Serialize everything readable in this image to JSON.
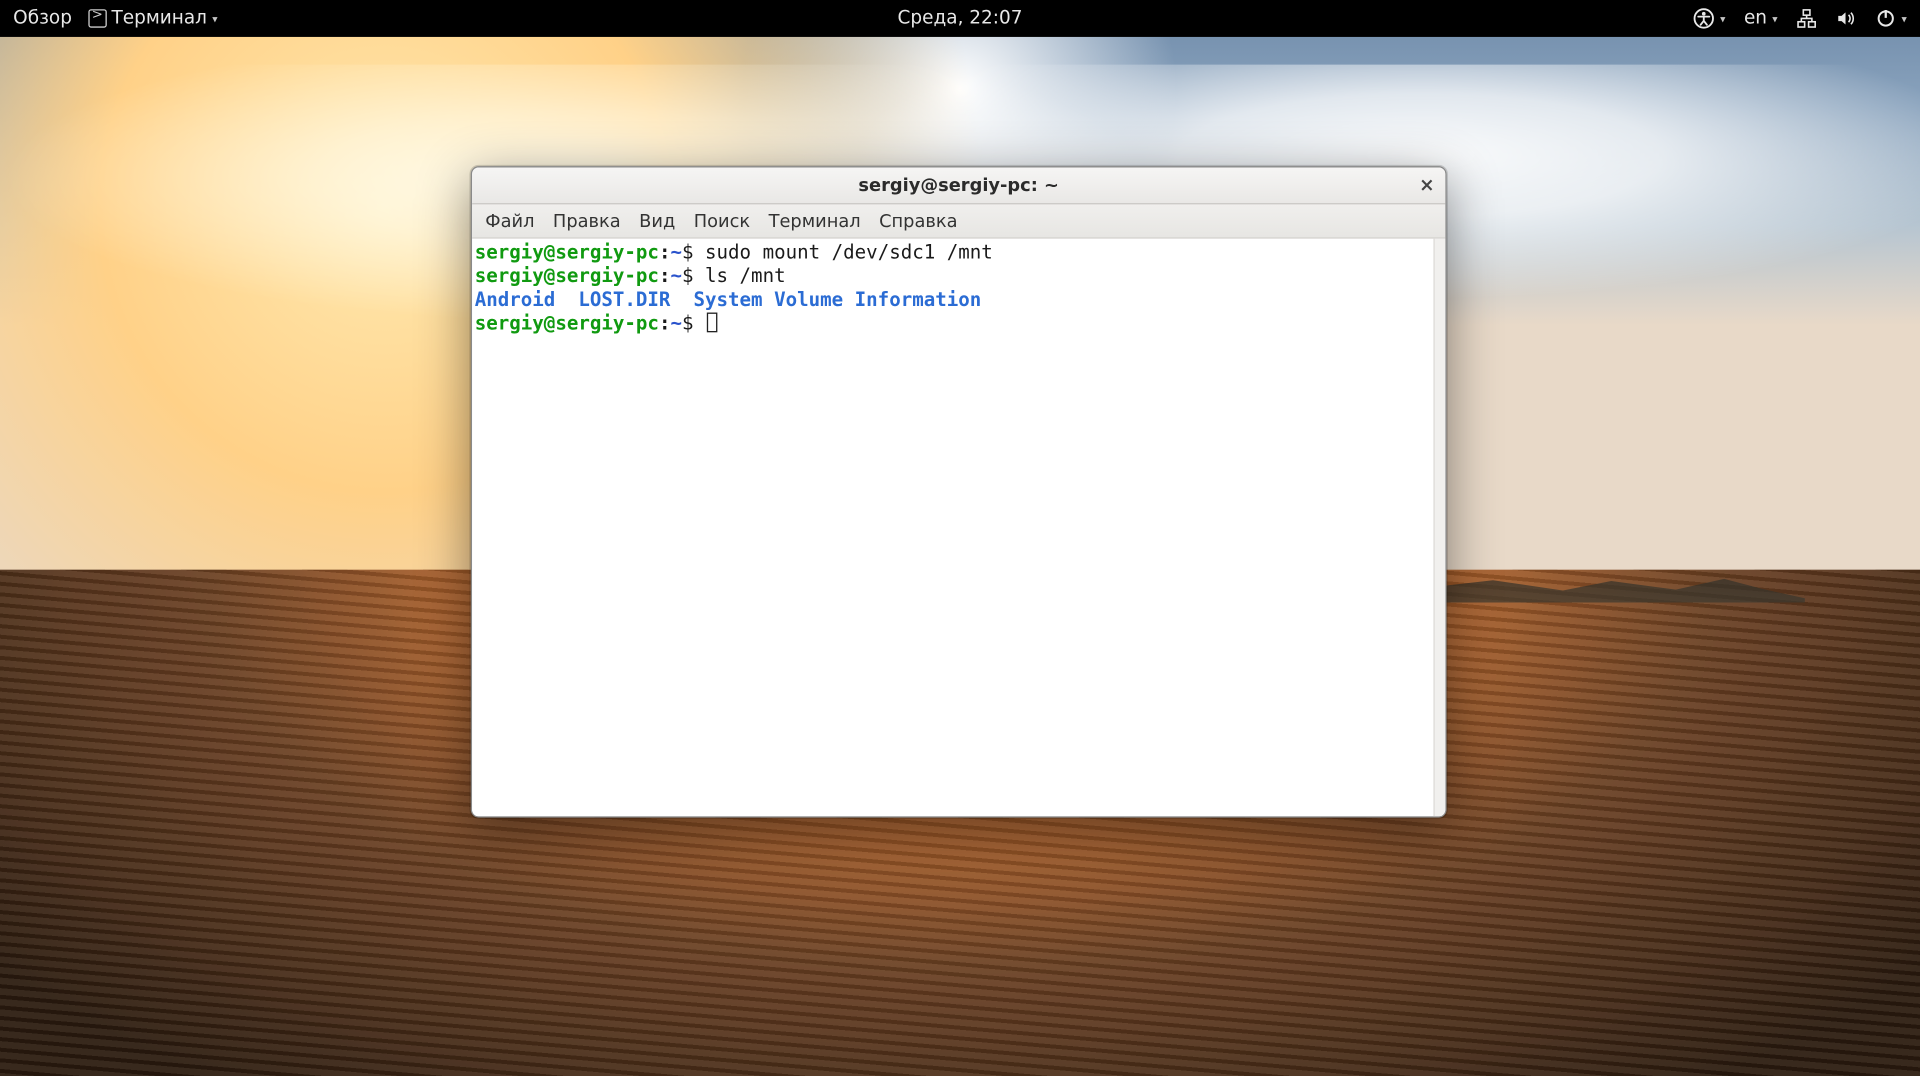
{
  "topbar": {
    "activities": "Обзор",
    "app_name": "Терминал",
    "clock": "Среда, 22:07",
    "input_lang": "en"
  },
  "window": {
    "title": "sergiy@sergiy-pc: ~",
    "menus": [
      "Файл",
      "Правка",
      "Вид",
      "Поиск",
      "Терминал",
      "Справка"
    ]
  },
  "prompt": {
    "userhost": "sergiy@sergiy-pc",
    "sep": ":",
    "path": "~",
    "sigil": "$"
  },
  "terminal": {
    "lines": [
      {
        "type": "cmd",
        "text": "sudo mount /dev/sdc1 /mnt"
      },
      {
        "type": "cmd",
        "text": "ls /mnt"
      },
      {
        "type": "dirs",
        "items": [
          "Android",
          "LOST.DIR",
          "System Volume Information"
        ]
      },
      {
        "type": "prompt"
      }
    ]
  }
}
